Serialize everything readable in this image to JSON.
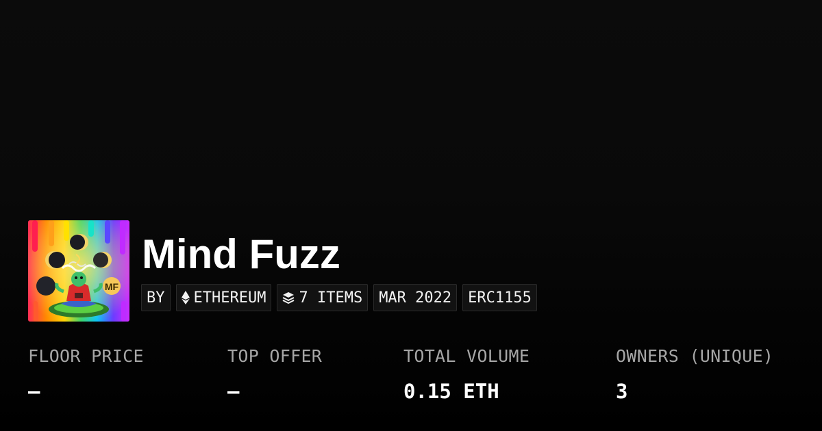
{
  "collection": {
    "title": "Mind Fuzz",
    "image_icon": "collection-artwork-image"
  },
  "meta": {
    "by_label": "BY",
    "chain_label": "ETHEREUM",
    "chain_icon": "ethereum-icon",
    "items_label": "7 ITEMS",
    "items_icon": "layers-icon",
    "date_label": "MAR 2022",
    "standard_label": "ERC1155"
  },
  "stats": [
    {
      "label": "FLOOR PRICE",
      "value": "–"
    },
    {
      "label": "TOP OFFER",
      "value": "–"
    },
    {
      "label": "TOTAL VOLUME",
      "value": "0.15 ETH"
    },
    {
      "label": "OWNERS (UNIQUE)",
      "value": "3"
    }
  ],
  "colors": {
    "background": "#0b0b0b",
    "text_primary": "#ffffff",
    "text_muted": "#a6a6a6",
    "chip_bg": "#121212",
    "chip_border": "#2a2a2a"
  }
}
